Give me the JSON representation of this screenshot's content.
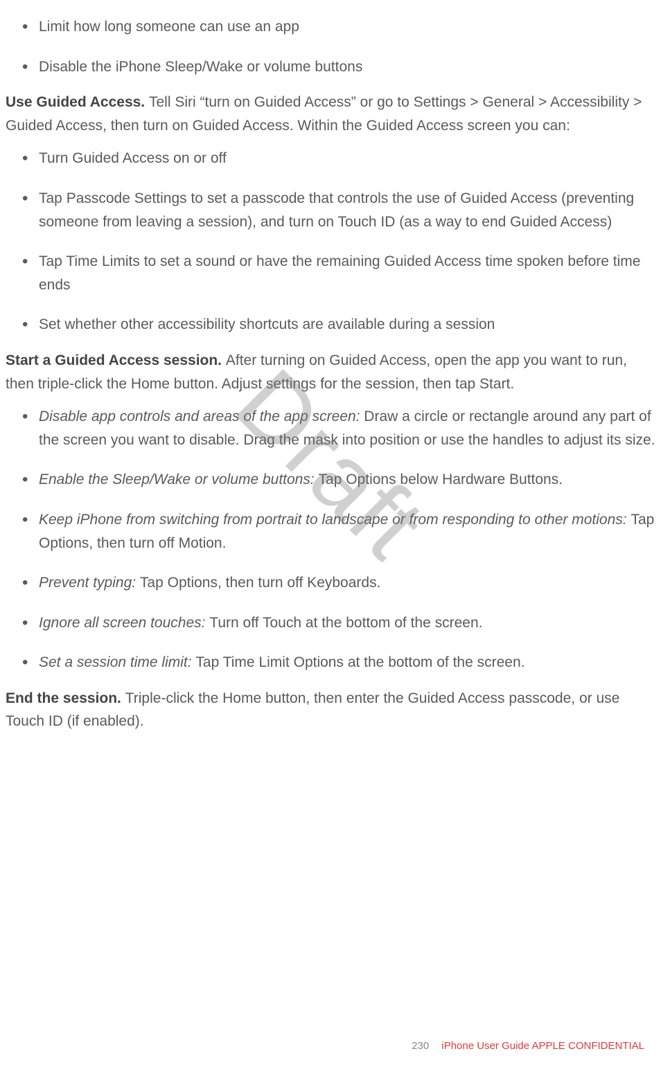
{
  "watermark": "Draft",
  "list1": {
    "i0": "Limit how long someone can use an app",
    "i1": "Disable the iPhone Sleep/Wake or volume buttons"
  },
  "p1": {
    "bold": "Use Guided Access. ",
    "rest": "Tell Siri “turn on Guided Access” or go to Settings > General > Accessibility > Guided Access, then turn on Guided Access. Within the Guided Access screen you can:"
  },
  "list2": {
    "i0": "Turn Guided Access on or off",
    "i1": "Tap Passcode Settings to set a passcode that controls the use of Guided Access (preventing someone from leaving a session), and turn on Touch ID (as a way to end Guided Access)",
    "i2": "Tap Time Limits to set a sound or have the remaining Guided Access time spoken before time ends",
    "i3": "Set whether other accessibility shortcuts are available during a session"
  },
  "p2": {
    "bold": "Start a Guided Access session. ",
    "rest": "After turning on Guided Access, open the app you want to run, then triple-click the Home button. Adjust settings for the session, then tap Start."
  },
  "list3": {
    "i0ital": "Disable app controls and areas of the app screen: ",
    "i0rest": "Draw a circle or rectangle around any part of the screen you want to disable. Drag the mask into position or use the handles to adjust its size.",
    "i1ital": "Enable the Sleep/Wake or volume buttons: ",
    "i1rest": "Tap Options below Hardware Buttons.",
    "i2ital": "Keep iPhone from switching from portrait to landscape or from responding to other motions: ",
    "i2rest": "Tap Options, then turn off Motion.",
    "i3ital": "Prevent typing: ",
    "i3rest": "Tap Options, then turn off Keyboards.",
    "i4ital": "Ignore all screen touches: ",
    "i4rest": "Turn off Touch at the bottom of the screen.",
    "i5ital": "Set a session time limit: ",
    "i5rest": "Tap Time Limit Options at the bottom of the screen."
  },
  "p3": {
    "bold": "End the session. ",
    "rest": "Triple-click the Home button, then enter the Guided Access passcode, or use Touch ID (if enabled)."
  },
  "footer": {
    "page": "230",
    "title": "iPhone User Guide  APPLE CONFIDENTIAL"
  }
}
